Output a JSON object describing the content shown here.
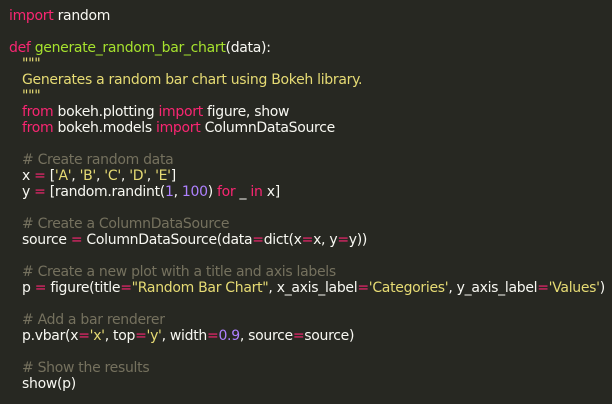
{
  "editor": {
    "background": "#272822",
    "colors": {
      "keyword": "#f92672",
      "function": "#a6e22e",
      "string": "#e6db74",
      "comment": "#75715e",
      "number": "#ae81ff",
      "builtin_keyword": "#66d9ef",
      "text": "#f8f8f2"
    },
    "lines": [
      {
        "indent": 0,
        "tokens": [
          {
            "c": "kw",
            "t": "import"
          },
          {
            "c": "txt",
            "t": " random"
          }
        ]
      },
      {
        "indent": 0,
        "tokens": []
      },
      {
        "indent": 0,
        "tokens": [
          {
            "c": "kw",
            "t": "def"
          },
          {
            "c": "txt",
            "t": " "
          },
          {
            "c": "fn",
            "t": "generate_random_bar_chart"
          },
          {
            "c": "txt",
            "t": "(data):"
          }
        ]
      },
      {
        "indent": 1,
        "tokens": [
          {
            "c": "str",
            "t": "\"\"\""
          }
        ]
      },
      {
        "indent": 1,
        "tokens": [
          {
            "c": "str",
            "t": "Generates a random bar chart using Bokeh library."
          }
        ]
      },
      {
        "indent": 1,
        "tokens": [
          {
            "c": "str",
            "t": "\"\"\""
          }
        ]
      },
      {
        "indent": 1,
        "tokens": [
          {
            "c": "kw",
            "t": "from"
          },
          {
            "c": "txt",
            "t": " bokeh.plotting "
          },
          {
            "c": "kw",
            "t": "import"
          },
          {
            "c": "txt",
            "t": " figure, show"
          }
        ]
      },
      {
        "indent": 1,
        "tokens": [
          {
            "c": "kw",
            "t": "from"
          },
          {
            "c": "txt",
            "t": " bokeh.models "
          },
          {
            "c": "kw",
            "t": "import"
          },
          {
            "c": "txt",
            "t": " ColumnDataSource"
          }
        ]
      },
      {
        "indent": 0,
        "tokens": []
      },
      {
        "indent": 1,
        "tokens": [
          {
            "c": "cmt",
            "t": "# Create random data"
          }
        ]
      },
      {
        "indent": 1,
        "tokens": [
          {
            "c": "txt",
            "t": "x "
          },
          {
            "c": "kw",
            "t": "="
          },
          {
            "c": "txt",
            "t": " ["
          },
          {
            "c": "str",
            "t": "'A'"
          },
          {
            "c": "txt",
            "t": ", "
          },
          {
            "c": "str",
            "t": "'B'"
          },
          {
            "c": "txt",
            "t": ", "
          },
          {
            "c": "str",
            "t": "'C'"
          },
          {
            "c": "txt",
            "t": ", "
          },
          {
            "c": "str",
            "t": "'D'"
          },
          {
            "c": "txt",
            "t": ", "
          },
          {
            "c": "str",
            "t": "'E'"
          },
          {
            "c": "txt",
            "t": "]"
          }
        ]
      },
      {
        "indent": 1,
        "tokens": [
          {
            "c": "txt",
            "t": "y "
          },
          {
            "c": "kw",
            "t": "="
          },
          {
            "c": "txt",
            "t": " [random.randint("
          },
          {
            "c": "num",
            "t": "1"
          },
          {
            "c": "txt",
            "t": ", "
          },
          {
            "c": "num",
            "t": "100"
          },
          {
            "c": "txt",
            "t": ") "
          },
          {
            "c": "kw",
            "t": "for"
          },
          {
            "c": "txt",
            "t": " _ "
          },
          {
            "c": "kw",
            "t": "in"
          },
          {
            "c": "txt",
            "t": " x]"
          }
        ]
      },
      {
        "indent": 0,
        "tokens": []
      },
      {
        "indent": 1,
        "tokens": [
          {
            "c": "cmt",
            "t": "# Create a ColumnDataSource"
          }
        ]
      },
      {
        "indent": 1,
        "tokens": [
          {
            "c": "txt",
            "t": "source "
          },
          {
            "c": "kw",
            "t": "="
          },
          {
            "c": "txt",
            "t": " ColumnDataSource(data"
          },
          {
            "c": "kw",
            "t": "="
          },
          {
            "c": "txt",
            "t": "dict(x"
          },
          {
            "c": "kw",
            "t": "="
          },
          {
            "c": "txt",
            "t": "x, y"
          },
          {
            "c": "kw",
            "t": "="
          },
          {
            "c": "txt",
            "t": "y))"
          }
        ]
      },
      {
        "indent": 0,
        "tokens": []
      },
      {
        "indent": 1,
        "tokens": [
          {
            "c": "cmt",
            "t": "# Create a new plot with a title and axis labels"
          }
        ]
      },
      {
        "indent": 1,
        "tokens": [
          {
            "c": "txt",
            "t": "p "
          },
          {
            "c": "kw",
            "t": "="
          },
          {
            "c": "txt",
            "t": " figure(title"
          },
          {
            "c": "kw",
            "t": "="
          },
          {
            "c": "str",
            "t": "\"Random Bar Chart\""
          },
          {
            "c": "txt",
            "t": ", x_axis_label"
          },
          {
            "c": "kw",
            "t": "="
          },
          {
            "c": "str",
            "t": "'Categories'"
          },
          {
            "c": "txt",
            "t": ", y_axis_label"
          },
          {
            "c": "kw",
            "t": "="
          },
          {
            "c": "str",
            "t": "'Values'"
          },
          {
            "c": "txt",
            "t": ")"
          }
        ]
      },
      {
        "indent": 0,
        "tokens": []
      },
      {
        "indent": 1,
        "tokens": [
          {
            "c": "cmt",
            "t": "# Add a bar renderer"
          }
        ]
      },
      {
        "indent": 1,
        "tokens": [
          {
            "c": "txt",
            "t": "p.vbar(x"
          },
          {
            "c": "kw",
            "t": "="
          },
          {
            "c": "str",
            "t": "'x'"
          },
          {
            "c": "txt",
            "t": ", top"
          },
          {
            "c": "kw",
            "t": "="
          },
          {
            "c": "str",
            "t": "'y'"
          },
          {
            "c": "txt",
            "t": ", width"
          },
          {
            "c": "kw",
            "t": "="
          },
          {
            "c": "num",
            "t": "0.9"
          },
          {
            "c": "txt",
            "t": ", source"
          },
          {
            "c": "kw",
            "t": "="
          },
          {
            "c": "txt",
            "t": "source)"
          }
        ]
      },
      {
        "indent": 0,
        "tokens": []
      },
      {
        "indent": 1,
        "tokens": [
          {
            "c": "cmt",
            "t": "# Show the results"
          }
        ]
      },
      {
        "indent": 1,
        "tokens": [
          {
            "c": "txt",
            "t": "show(p)"
          }
        ]
      }
    ]
  }
}
